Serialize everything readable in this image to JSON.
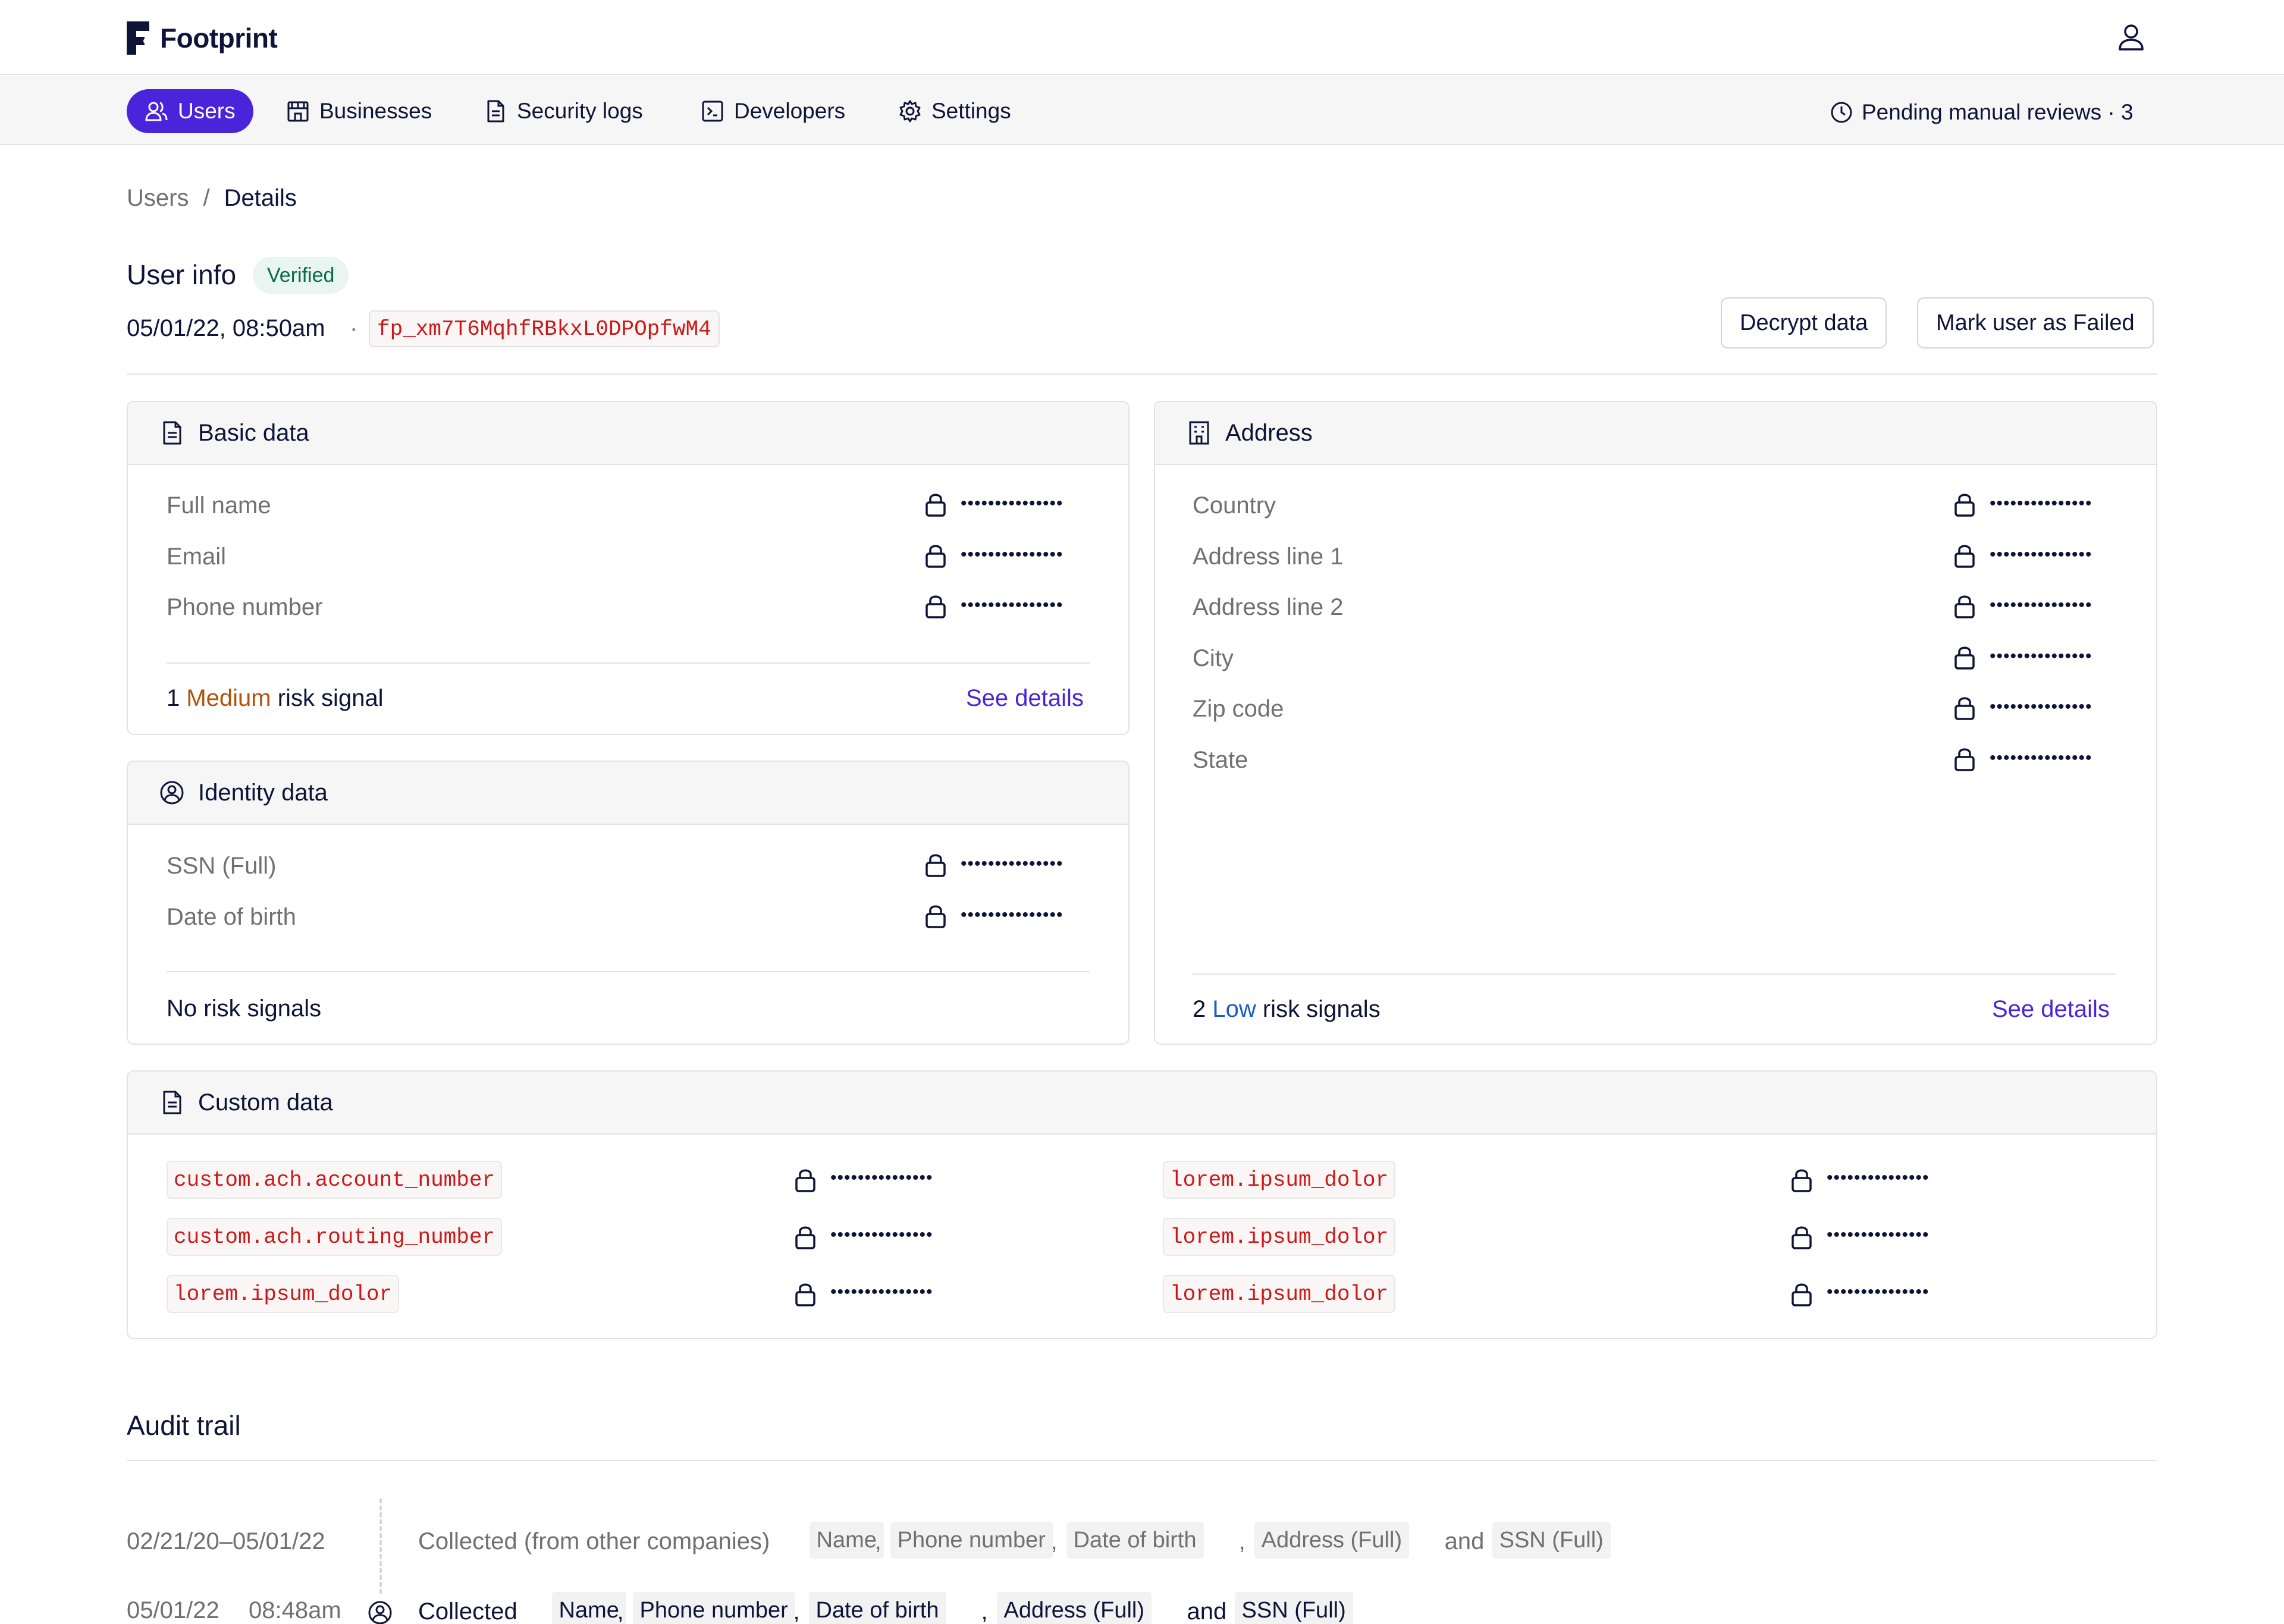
{
  "brand": {
    "name": "Footprint",
    "logo_icon": "footprint-logo-icon"
  },
  "header": {
    "user_icon": "user-icon"
  },
  "nav": {
    "items": [
      {
        "label": "Users",
        "icon": "users-icon",
        "active": true
      },
      {
        "label": "Businesses",
        "icon": "store-icon",
        "active": false
      },
      {
        "label": "Security logs",
        "icon": "file-text-icon",
        "active": false
      },
      {
        "label": "Developers",
        "icon": "terminal-icon",
        "active": false
      },
      {
        "label": "Settings",
        "icon": "gear-icon",
        "active": false
      }
    ],
    "pending": {
      "label": "Pending manual reviews · 3",
      "icon": "clock-icon"
    }
  },
  "breadcrumb": {
    "parent": "Users",
    "separator": "/",
    "current": "Details"
  },
  "user_info": {
    "title": "User info",
    "status": "Verified",
    "date": "05/01/22, 08:50am",
    "dot": "·",
    "id": "fp_xm7T6MqhfRBkxL0DPOpfwM4",
    "decrypt_label": "Decrypt data",
    "fail_label": "Mark user as Failed"
  },
  "masked": "•••••••••••••••",
  "basic_data": {
    "title": "Basic data",
    "fields": [
      "Full name",
      "Email",
      "Phone number"
    ],
    "risk": {
      "count": "1",
      "level": "Medium",
      "suffix": "risk signal"
    },
    "see_details": "See details"
  },
  "identity_data": {
    "title": "Identity data",
    "fields": [
      "SSN (Full)",
      "Date of birth"
    ],
    "risk_text": "No risk signals"
  },
  "address": {
    "title": "Address",
    "fields": [
      "Country",
      "Address line 1",
      "Address line 2",
      "City",
      "Zip code",
      "State"
    ],
    "risk": {
      "count": "2",
      "level": "Low",
      "suffix": "risk signals"
    },
    "see_details": "See details"
  },
  "custom_data": {
    "title": "Custom data",
    "left": [
      "custom.ach.account_number",
      "custom.ach.routing_number",
      "lorem.ipsum_dolor"
    ],
    "right": [
      "lorem.ipsum_dolor",
      "lorem.ipsum_dolor",
      "lorem.ipsum_dolor"
    ]
  },
  "audit": {
    "title": "Audit trail",
    "entries": [
      {
        "date": "02/21/20–05/01/22",
        "text": "Collected (from other companies)",
        "tags": [
          "Name",
          "Phone number",
          "Date of birth",
          "Address (Full)",
          "SSN (Full)"
        ],
        "comma": ",",
        "and": "and"
      },
      {
        "date": "05/01/22",
        "time": "08:48am",
        "text": "Collected",
        "tags": [
          "Name",
          "Phone number",
          "Date of birth",
          "Address (Full)",
          "SSN (Full)"
        ],
        "comma": ",",
        "and": "and"
      }
    ]
  },
  "colors": {
    "accent": "#4a24db",
    "medium": "#b3520a",
    "low": "#1a5dc7",
    "code": "#cb1919"
  }
}
